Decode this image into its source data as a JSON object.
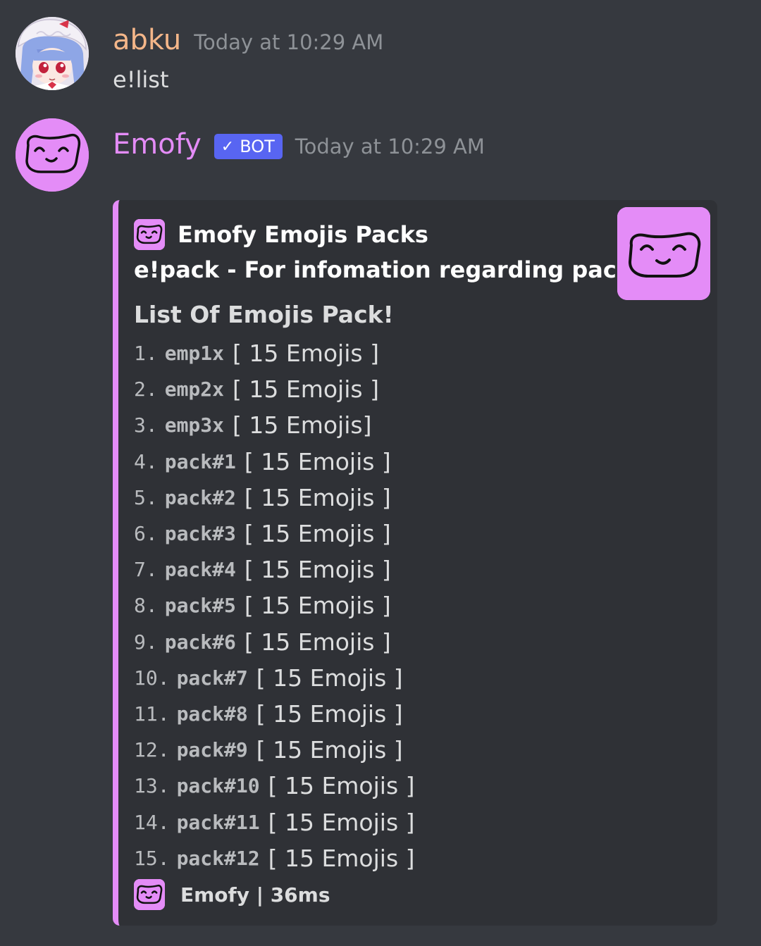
{
  "messages": [
    {
      "author": "abku",
      "timestamp": "Today at 10:29 AM",
      "content": "e!list",
      "avatar_icon": "anime-girl-avatar-icon"
    },
    {
      "author": "Emofy",
      "bot_tag": "BOT",
      "bot_check": "✓",
      "timestamp": "Today at 10:29 AM",
      "avatar_icon": "smiley-face-avatar-icon",
      "embed": {
        "author_name": "Emofy Emojis Packs",
        "title": "e!pack - For infomation regarding packs.",
        "heading": "List Of Emojis Pack!",
        "items": [
          {
            "num": "1.",
            "code": "emp1x",
            "count": "[ 15 Emojis ]"
          },
          {
            "num": "2.",
            "code": "emp2x",
            "count": "[ 15 Emojis ]"
          },
          {
            "num": "3.",
            "code": "emp3x",
            "count": "[ 15 Emojis]"
          },
          {
            "num": "4.",
            "code": "pack#1",
            "count": "[ 15 Emojis ]"
          },
          {
            "num": "5.",
            "code": "pack#2",
            "count": "[ 15 Emojis ]"
          },
          {
            "num": "6.",
            "code": "pack#3",
            "count": "[ 15 Emojis ]"
          },
          {
            "num": "7.",
            "code": "pack#4",
            "count": "[ 15 Emojis ]"
          },
          {
            "num": "8.",
            "code": "pack#5",
            "count": "[ 15 Emojis ]"
          },
          {
            "num": "9.",
            "code": "pack#6",
            "count": "[ 15 Emojis ]"
          },
          {
            "num": "10.",
            "code": "pack#7",
            "count": "[ 15 Emojis ]"
          },
          {
            "num": "11.",
            "code": "pack#8",
            "count": "[ 15 Emojis ]"
          },
          {
            "num": "12.",
            "code": "pack#9",
            "count": "[ 15 Emojis ]"
          },
          {
            "num": "13.",
            "code": "pack#10",
            "count": "[ 15 Emojis ]"
          },
          {
            "num": "14.",
            "code": "pack#11",
            "count": "[ 15 Emojis ]"
          },
          {
            "num": "15.",
            "code": "pack#12",
            "count": "[ 15 Emojis ]"
          }
        ],
        "footer": "Emofy | 36ms"
      }
    }
  ],
  "colors": {
    "background": "#36393f",
    "embed_background": "#2f3136",
    "accent_pink": "#e48cf7",
    "abku_name": "#f4b689",
    "bot_tag": "#5865f2",
    "timestamp": "#8e9297"
  }
}
